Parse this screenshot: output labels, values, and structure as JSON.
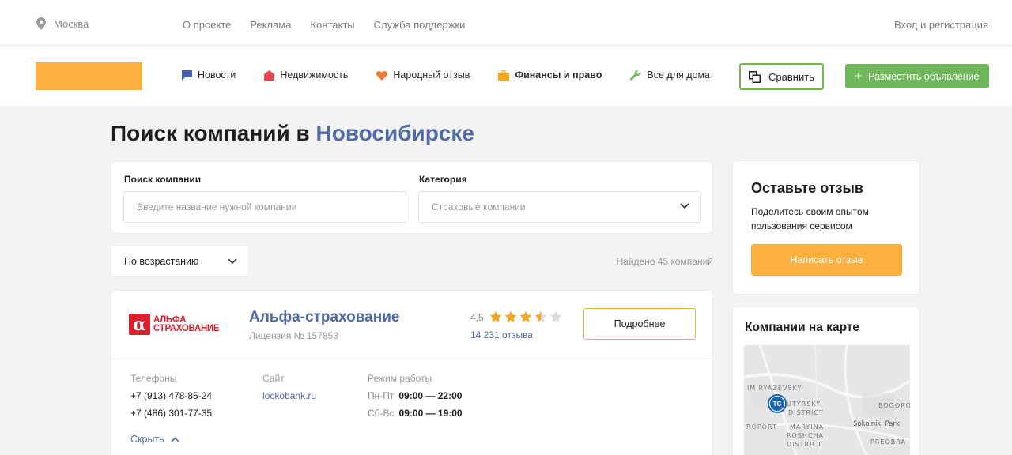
{
  "topbar": {
    "city": "Москва",
    "nav": [
      "О проекте",
      "Реклама",
      "Контакты",
      "Служба поддержки"
    ],
    "login": "Вход и регистрация"
  },
  "header": {
    "categories": [
      {
        "label": "Новости",
        "icon": "chat-icon",
        "color": "#4460b5"
      },
      {
        "label": "Недвижимость",
        "icon": "house-icon",
        "color": "#e5484d"
      },
      {
        "label": "Народный отзыв",
        "icon": "heart-icon",
        "color": "#f07a3a"
      },
      {
        "label": "Финансы и право",
        "icon": "briefcase-icon",
        "color": "#f5a623"
      },
      {
        "label": "Все для дома",
        "icon": "wrench-icon",
        "color": "#6eb85b"
      }
    ],
    "compare_label": "Сравнить",
    "post_label": "Разместить объявление"
  },
  "page": {
    "title_prefix": "Поиск компаний в",
    "title_city": "Новосибирске"
  },
  "search": {
    "company_label": "Поиск компании",
    "company_placeholder": "Введите название нужной компании",
    "category_label": "Категория",
    "category_value": "Страховые компании"
  },
  "sort": {
    "value": "По возрастанию",
    "found": "Найдено 45 компаний"
  },
  "company": {
    "logo_text_line1": "АЛЬФА",
    "logo_text_line2": "СТРАХОВАНИЕ",
    "name": "Альфа-страхование",
    "license": "Лицензия № 157853",
    "rating": "4,5",
    "rating_value": 3.5,
    "rating_max": 5,
    "reviews": "14 231 отзыва",
    "more_label": "Подробнее",
    "phones_label": "Телефоны",
    "phones": [
      "+7 (913) 478-85-24",
      "+7 (486) 301-77-35"
    ],
    "site_label": "Сайт",
    "site": "lockobank.ru",
    "schedule_label": "Режим работы",
    "schedule": [
      {
        "days": "Пн-Пт",
        "time": "09:00 — 22:00"
      },
      {
        "days": "Сб-Вс",
        "time": "09:00 — 19:00"
      }
    ],
    "collapse_label": "Скрыть"
  },
  "review_box": {
    "title": "Оставьте отзыв",
    "text": "Поделитесь своим опытом пользования сервисом",
    "button": "Написать отзыв"
  },
  "map": {
    "title": "Компании на карте",
    "labels": [
      "IMIRYAZEVSKY",
      "UTYRSKY",
      "DISTRICT",
      "ROPORT",
      "MARYINA",
      "ROSHCHA",
      "DISTRICT",
      "Sokolniki Park",
      "BOGORO",
      "PREOBRA"
    ],
    "marker_text": "ТС"
  },
  "colors": {
    "accent_blue": "#4f6aa6",
    "accent_orange": "#fbb040",
    "accent_green": "#6eb85b",
    "star": "#f5a623"
  }
}
